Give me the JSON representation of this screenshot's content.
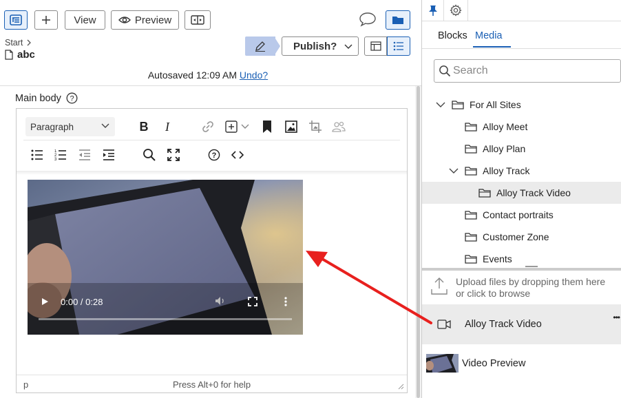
{
  "toolbar": {
    "view_label": "View",
    "preview_label": "Preview",
    "publish_label": "Publish?"
  },
  "breadcrumb": {
    "start": "Start"
  },
  "page": {
    "name": "abc"
  },
  "autosave": {
    "text": "Autosaved 12:09 AM",
    "undo": "Undo?"
  },
  "editor": {
    "field_label": "Main body",
    "paragraph_select": "Paragraph",
    "video_time": "0:00 / 0:28",
    "video_progress": 0,
    "status_path": "p",
    "status_help": "Press Alt+0 for help"
  },
  "panel": {
    "tabs": [
      "Blocks",
      "Media"
    ],
    "active_tab": "Media",
    "search_placeholder": "Search",
    "tree": [
      {
        "label": "For All Sites",
        "expanded": true,
        "level": 0
      },
      {
        "label": "Alloy Meet",
        "level": 1
      },
      {
        "label": "Alloy Plan",
        "level": 1
      },
      {
        "label": "Alloy Track",
        "expanded": true,
        "level": 1
      },
      {
        "label": "Alloy Track Video",
        "level": 2,
        "selected": true
      },
      {
        "label": "Contact portraits",
        "level": 1
      },
      {
        "label": "Customer Zone",
        "level": 1
      },
      {
        "label": "Events",
        "level": 1
      }
    ],
    "upload_line1": "Upload files by dropping them here",
    "upload_line2": "or click to browse",
    "media_item": "Alloy Track Video",
    "media_menu": "•••",
    "preview_item": "Video Preview"
  },
  "colors": {
    "accent": "#1a5fb4",
    "annotation_arrow": "#e8201e"
  }
}
